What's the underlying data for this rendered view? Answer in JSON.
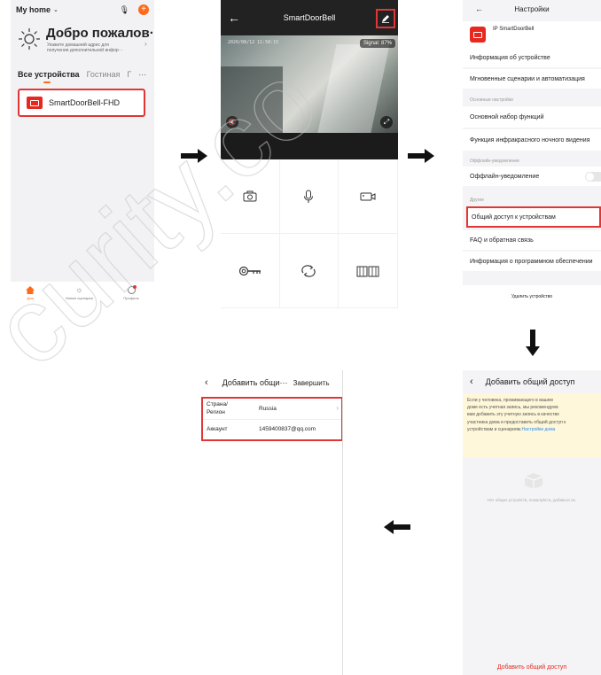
{
  "panel_home": {
    "home_name": "My home",
    "welcome_title": "Добро пожалов···",
    "welcome_sub_1": "Укажите домашний адрес для",
    "welcome_sub_2": "получения дополнительной инфор···",
    "tabs": [
      "Все устройства",
      "Гостиная",
      "Г"
    ],
    "tabs_more": "···",
    "device_name": "SmartDoorBell-FHD",
    "nav": [
      "Дом",
      "Умные сценарии",
      "Профиль"
    ]
  },
  "panel_camera": {
    "title": "SmartDoorBell",
    "timestamp": "2020/08/12 11:58:15",
    "signal": "Signal: 87%"
  },
  "panel_settings": {
    "title": "Настройки",
    "device_name": "IP SmartDoorBell",
    "rows": [
      "Информация об устройстве",
      "Мгновенные сценарии и автоматизация",
      "Основной набор функций",
      "Функция инфракрасного ночного видения",
      "Оффлайн-уведомление",
      "Общий доступ к устройствам",
      "FAQ и обратная связь",
      "Информация о программном обеспечении"
    ],
    "sections": [
      "Основные настройки",
      "Оффлайн-уведомление",
      "Другие"
    ],
    "delete_label": "Удалить устройство"
  },
  "panel_form": {
    "title": "Добавить общи···",
    "done_label": "Завершить",
    "country_label_1": "Страна/",
    "country_label_2": "Регион",
    "country_value": "Russia",
    "account_label": "Аккаунт",
    "account_value": "1459400837@qq.com"
  },
  "panel_share": {
    "title": "Добавить общий доступ",
    "info_1": "Если у человека, проживающего в вашем",
    "info_2": "доме есть учетная запись, мы рекомендуем",
    "info_3": "вам добавить эту учетную запись в качестве",
    "info_4": "участника дома и предоставить общий доступ к",
    "info_5": "устройствам и сценариям.",
    "info_link": "Настройки дома",
    "empty_text": "Нет общих устройств, пожалуйста, добавьте их.",
    "add_button": "Добавить общий доступ"
  },
  "colors": {
    "accent": "#ff6a1a",
    "highlight": "#e03636",
    "link": "#2f8cf0",
    "info_bg": "#fff7d9"
  },
  "watermark": "curity.co"
}
